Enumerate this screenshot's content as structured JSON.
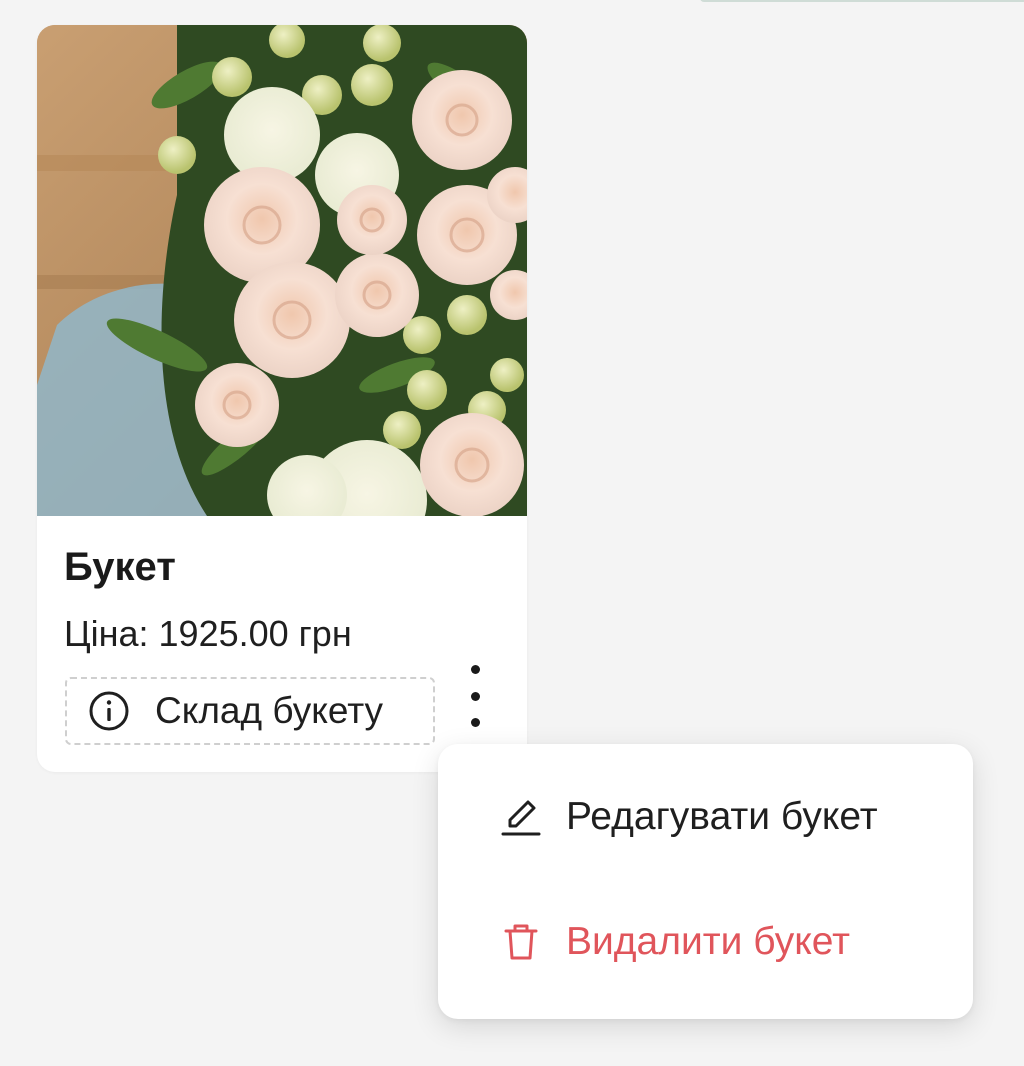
{
  "product_card": {
    "image_alt": "Букет",
    "title": "Букет",
    "price": "Ціна: 1925.00 грн",
    "composition_button": {
      "label": "Склад букету",
      "icon": "info-icon"
    },
    "more_menu_icon": "kebab-vertical-icon"
  },
  "context_menu": {
    "items": [
      {
        "label": "Редагувати букет",
        "icon": "pencil-edit-icon",
        "color": "#1f1f1f"
      },
      {
        "label": "Видалити букет",
        "icon": "trash-icon",
        "color": "#e0555b"
      }
    ]
  },
  "colors": {
    "background": "#f4f4f4",
    "card": "#ffffff",
    "danger": "#e0555b",
    "text": "#1f1f1f"
  }
}
